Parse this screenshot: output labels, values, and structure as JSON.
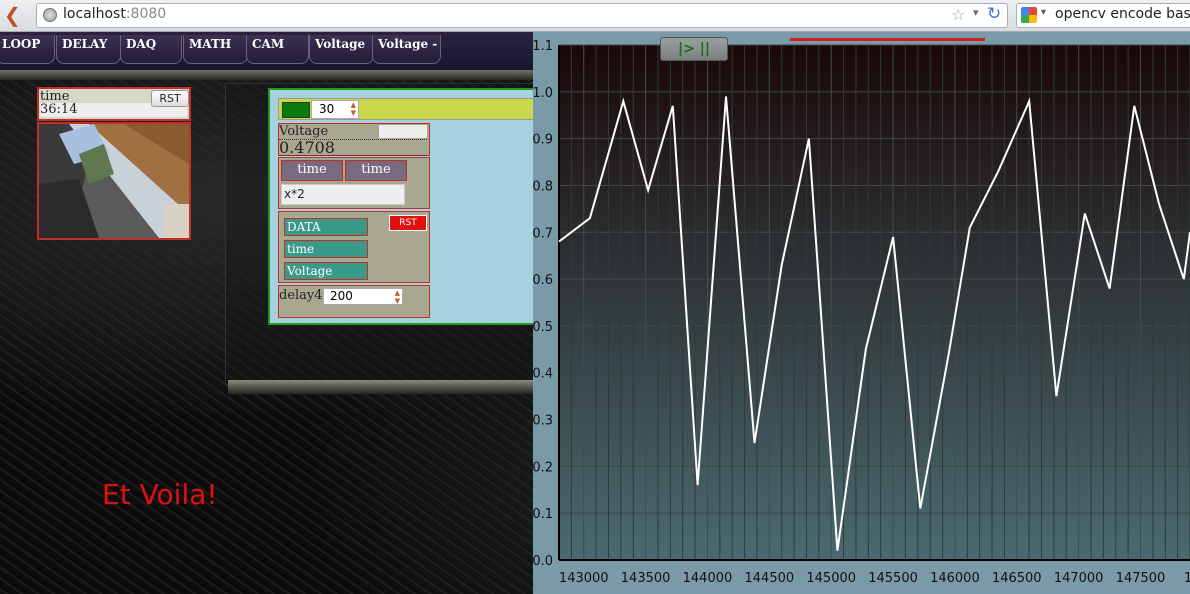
{
  "browser": {
    "url_host": "localhost",
    "url_port": ":8080",
    "search_text": "opencv encode base"
  },
  "menu": {
    "items": [
      "LOOP",
      "DELAY",
      "DAQ",
      "MATH",
      "CAM",
      "Voltage",
      "Voltage -"
    ]
  },
  "time_widget": {
    "label": "time",
    "value": "36:14",
    "reset_label": "RST"
  },
  "control_panel": {
    "spinner_value": "30",
    "voltage": {
      "label": "Voltage",
      "value": "0.4708"
    },
    "math": {
      "inputs": [
        "time",
        "time"
      ],
      "expression": "x*2"
    },
    "daq": {
      "reset_label": "RST",
      "channels": [
        "DATA",
        "time",
        "Voltage"
      ]
    },
    "delay": {
      "label": "delay4",
      "value": "200"
    }
  },
  "caption": "Et Voila!",
  "chart": {
    "play_label": "|> ||"
  },
  "chart_data": {
    "type": "line",
    "title": "",
    "xlabel": "",
    "ylabel": "",
    "xlim": [
      142800,
      147900
    ],
    "ylim": [
      0.0,
      1.1
    ],
    "xticks": [
      143000,
      143500,
      144000,
      144500,
      145000,
      145500,
      146000,
      146500,
      147000,
      147500
    ],
    "xtick_labels": [
      "143000",
      "143500",
      "144000",
      "144500",
      "145000",
      "145500",
      "146000",
      "146500",
      "147000",
      "147500",
      "1"
    ],
    "yticks": [
      0.0,
      0.1,
      0.2,
      0.3,
      0.4,
      0.5,
      0.6,
      0.7,
      0.8,
      0.9,
      1.0,
      1.1
    ],
    "ytick_labels": [
      "0.0",
      "0.1",
      "0.2",
      "0.3",
      "0.4",
      "0.5",
      "0.6",
      "0.7",
      "0.8",
      "0.9",
      "1.0",
      "1.1"
    ],
    "grid": true,
    "series": [
      {
        "color": "#ffffff",
        "x": [
          142800,
          143050,
          143320,
          143520,
          143720,
          143920,
          144150,
          144380,
          144600,
          144820,
          145050,
          145280,
          145500,
          145720,
          145950,
          146120,
          146350,
          146600,
          146820,
          147050,
          147250,
          147450,
          147650,
          147850,
          147900
        ],
        "y": [
          0.68,
          0.73,
          0.98,
          0.79,
          0.97,
          0.16,
          0.99,
          0.25,
          0.63,
          0.9,
          0.02,
          0.45,
          0.69,
          0.11,
          0.44,
          0.71,
          0.83,
          0.98,
          0.35,
          0.74,
          0.58,
          0.97,
          0.76,
          0.6,
          0.7
        ]
      }
    ],
    "colors": {
      "plot_bg_top": "#1a0808",
      "plot_bg_bottom": "#4a6a70",
      "frame": "#7a9aa8",
      "line": "#ffffff"
    }
  }
}
